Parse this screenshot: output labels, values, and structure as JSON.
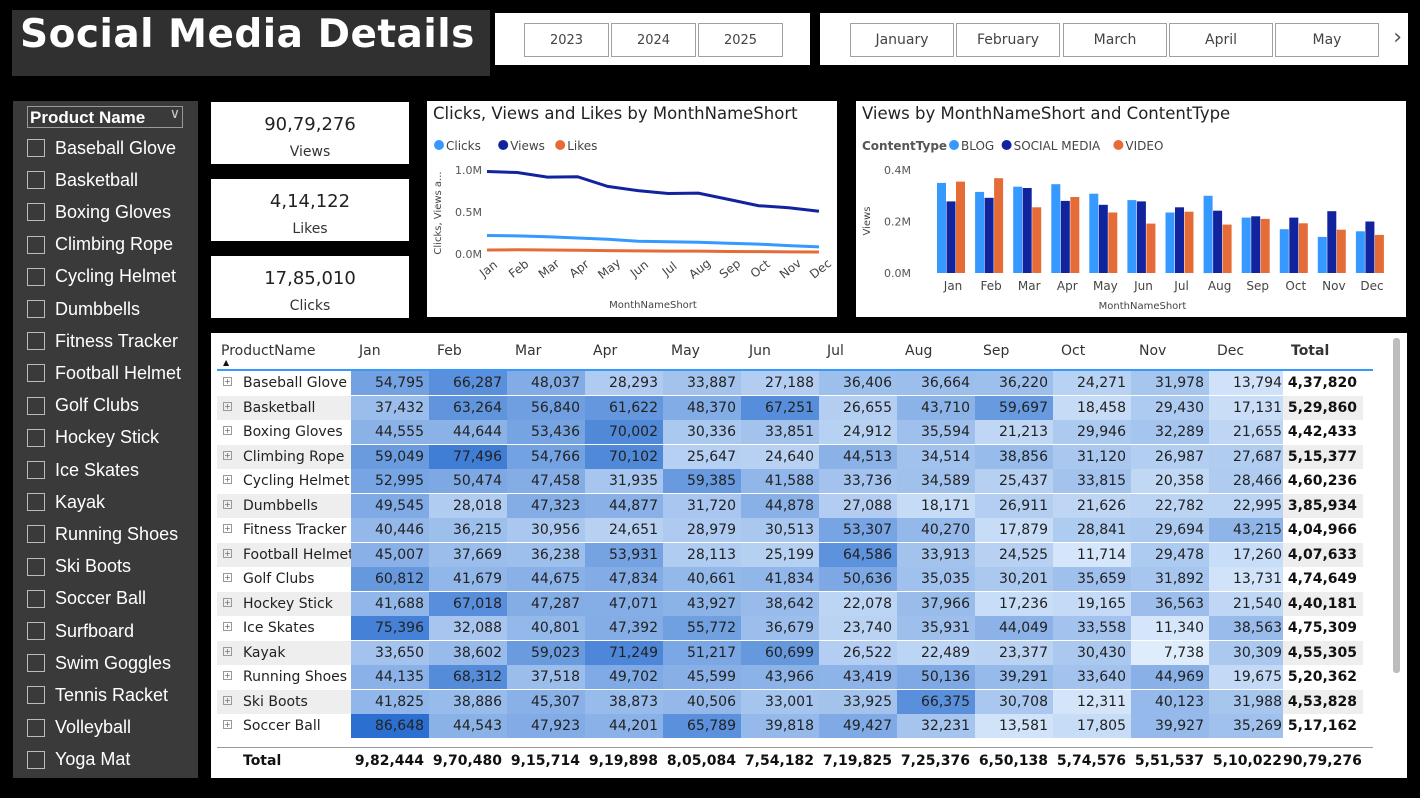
{
  "header": {
    "title": "Social Media Details"
  },
  "year_slicer": {
    "years": [
      "2023",
      "2024",
      "2025"
    ]
  },
  "month_slicer": {
    "months": [
      "January",
      "February",
      "March",
      "April",
      "May"
    ],
    "next_icon": "chevron-right-icon"
  },
  "product_slicer": {
    "title": "Product Name",
    "items": [
      "Baseball Glove",
      "Basketball",
      "Boxing Gloves",
      "Climbing Rope",
      "Cycling Helmet",
      "Dumbbells",
      "Fitness Tracker",
      "Football Helmet",
      "Golf Clubs",
      "Hockey Stick",
      "Ice Skates",
      "Kayak",
      "Running Shoes",
      "Ski Boots",
      "Soccer Ball",
      "Surfboard",
      "Swim Goggles",
      "Tennis Racket",
      "Volleyball",
      "Yoga Mat"
    ]
  },
  "cards": [
    {
      "value": "90,79,276",
      "label": "Views"
    },
    {
      "value": "4,14,122",
      "label": "Likes"
    },
    {
      "value": "17,85,010",
      "label": "Clicks"
    }
  ],
  "chart_data": [
    {
      "type": "line",
      "title": "Clicks, Views and Likes by MonthNameShort",
      "xlabel": "MonthNameShort",
      "ylabel": "Clicks, Views a...",
      "x": [
        "Jan",
        "Feb",
        "Mar",
        "Apr",
        "May",
        "Jun",
        "Jul",
        "Aug",
        "Sep",
        "Oct",
        "Nov",
        "Dec"
      ],
      "yticks": [
        "1.0M",
        "0.5M",
        "0.0M"
      ],
      "ylim": [
        0,
        1000000
      ],
      "legend_position": "top-left",
      "series": [
        {
          "name": "Clicks",
          "color": "#3599ff",
          "values": [
            220000,
            215000,
            205000,
            190000,
            175000,
            152000,
            145000,
            140000,
            128000,
            118000,
            100000,
            85000
          ]
        },
        {
          "name": "Views",
          "color": "#12239e",
          "values": [
            982444,
            970480,
            915714,
            919898,
            805084,
            754182,
            719825,
            725376,
            650138,
            574576,
            551537,
            510022
          ]
        },
        {
          "name": "Likes",
          "color": "#e66c37",
          "values": [
            48000,
            50000,
            48000,
            44000,
            40000,
            37000,
            35000,
            34000,
            30000,
            28000,
            25000,
            24000
          ]
        }
      ]
    },
    {
      "type": "bar",
      "title": "Views by MonthNameShort and ContentType",
      "xlabel": "MonthNameShort",
      "ylabel": "Views",
      "legend_title": "ContentType",
      "categories": [
        "Jan",
        "Feb",
        "Mar",
        "Apr",
        "May",
        "Jun",
        "Jul",
        "Aug",
        "Sep",
        "Oct",
        "Nov",
        "Dec"
      ],
      "yticks": [
        "0.4M",
        "0.2M",
        "0.0M"
      ],
      "ylim": [
        0,
        400000
      ],
      "series": [
        {
          "name": "BLOG",
          "color": "#3599ff",
          "values": [
            350000,
            315000,
            335000,
            345000,
            308000,
            283000,
            235000,
            300000,
            215000,
            170000,
            140000,
            162000
          ]
        },
        {
          "name": "SOCIAL MEDIA",
          "color": "#12239e",
          "values": [
            278000,
            292000,
            330000,
            280000,
            265000,
            278000,
            255000,
            242000,
            220000,
            215000,
            240000,
            200000
          ]
        },
        {
          "name": "VIDEO",
          "color": "#e66c37",
          "values": [
            355000,
            368000,
            255000,
            295000,
            235000,
            192000,
            238000,
            188000,
            210000,
            193000,
            168000,
            148000
          ]
        }
      ]
    }
  ],
  "matrix": {
    "columns": [
      "ProductName",
      "Jan",
      "Feb",
      "Mar",
      "Apr",
      "May",
      "Jun",
      "Jul",
      "Aug",
      "Sep",
      "Oct",
      "Nov",
      "Dec",
      "Total"
    ],
    "rows": [
      {
        "name": "Baseball Glove",
        "values": [
          "54,795",
          "66,287",
          "48,037",
          "28,293",
          "33,887",
          "27,188",
          "36,406",
          "36,664",
          "36,220",
          "24,271",
          "31,978",
          "13,794"
        ],
        "total": "4,37,820"
      },
      {
        "name": "Basketball",
        "values": [
          "37,432",
          "63,264",
          "56,840",
          "61,622",
          "48,370",
          "67,251",
          "26,655",
          "43,710",
          "59,697",
          "18,458",
          "29,430",
          "17,131"
        ],
        "total": "5,29,860"
      },
      {
        "name": "Boxing Gloves",
        "values": [
          "44,555",
          "44,644",
          "53,436",
          "70,002",
          "30,336",
          "33,851",
          "24,912",
          "35,594",
          "21,213",
          "29,946",
          "32,289",
          "21,655"
        ],
        "total": "4,42,433"
      },
      {
        "name": "Climbing Rope",
        "values": [
          "59,049",
          "77,496",
          "54,766",
          "70,102",
          "25,647",
          "24,640",
          "44,513",
          "34,514",
          "38,856",
          "31,120",
          "26,987",
          "27,687"
        ],
        "total": "5,15,377"
      },
      {
        "name": "Cycling Helmet",
        "values": [
          "52,995",
          "50,474",
          "47,458",
          "31,935",
          "59,385",
          "41,588",
          "33,736",
          "34,589",
          "25,437",
          "33,815",
          "20,358",
          "28,466"
        ],
        "total": "4,60,236"
      },
      {
        "name": "Dumbbells",
        "values": [
          "49,545",
          "28,018",
          "47,323",
          "44,877",
          "31,720",
          "44,878",
          "27,088",
          "18,171",
          "26,911",
          "21,626",
          "22,782",
          "22,995"
        ],
        "total": "3,85,934"
      },
      {
        "name": "Fitness Tracker",
        "values": [
          "40,446",
          "36,215",
          "30,956",
          "24,651",
          "28,979",
          "30,513",
          "53,307",
          "40,270",
          "17,879",
          "28,841",
          "29,694",
          "43,215"
        ],
        "total": "4,04,966"
      },
      {
        "name": "Football Helmet",
        "values": [
          "45,007",
          "37,669",
          "36,238",
          "53,931",
          "28,113",
          "25,199",
          "64,586",
          "33,913",
          "24,525",
          "11,714",
          "29,478",
          "17,260"
        ],
        "total": "4,07,633"
      },
      {
        "name": "Golf Clubs",
        "values": [
          "60,812",
          "41,679",
          "44,675",
          "47,834",
          "40,661",
          "41,834",
          "50,636",
          "35,035",
          "30,201",
          "35,659",
          "31,892",
          "13,731"
        ],
        "total": "4,74,649"
      },
      {
        "name": "Hockey Stick",
        "values": [
          "41,688",
          "67,018",
          "47,287",
          "47,071",
          "43,927",
          "38,642",
          "22,078",
          "37,966",
          "17,236",
          "19,165",
          "36,563",
          "21,540"
        ],
        "total": "4,40,181"
      },
      {
        "name": "Ice Skates",
        "values": [
          "75,396",
          "32,088",
          "40,801",
          "47,392",
          "55,772",
          "36,679",
          "23,740",
          "35,931",
          "44,049",
          "33,558",
          "11,340",
          "38,563"
        ],
        "total": "4,75,309"
      },
      {
        "name": "Kayak",
        "values": [
          "33,650",
          "38,602",
          "59,023",
          "71,249",
          "51,217",
          "60,699",
          "26,522",
          "22,489",
          "23,377",
          "30,430",
          "7,738",
          "30,309"
        ],
        "total": "4,55,305"
      },
      {
        "name": "Running Shoes",
        "values": [
          "44,135",
          "68,312",
          "37,518",
          "49,702",
          "45,599",
          "43,966",
          "43,419",
          "50,136",
          "39,291",
          "33,640",
          "44,969",
          "19,675"
        ],
        "total": "5,20,362"
      },
      {
        "name": "Ski Boots",
        "values": [
          "41,825",
          "38,886",
          "45,307",
          "38,873",
          "40,506",
          "33,001",
          "33,925",
          "66,375",
          "30,708",
          "12,311",
          "40,123",
          "31,988"
        ],
        "total": "4,53,828"
      },
      {
        "name": "Soccer Ball",
        "values": [
          "86,648",
          "44,543",
          "47,923",
          "44,201",
          "65,789",
          "39,818",
          "49,427",
          "32,231",
          "13,581",
          "17,805",
          "39,927",
          "35,269"
        ],
        "total": "5,17,162"
      }
    ],
    "total_row": {
      "label": "Total",
      "values": [
        "9,82,444",
        "9,70,480",
        "9,15,714",
        "9,19,898",
        "8,05,084",
        "7,54,182",
        "7,19,825",
        "7,25,376",
        "6,50,138",
        "5,74,576",
        "5,51,537",
        "5,10,022"
      ],
      "total": "90,79,276"
    }
  }
}
